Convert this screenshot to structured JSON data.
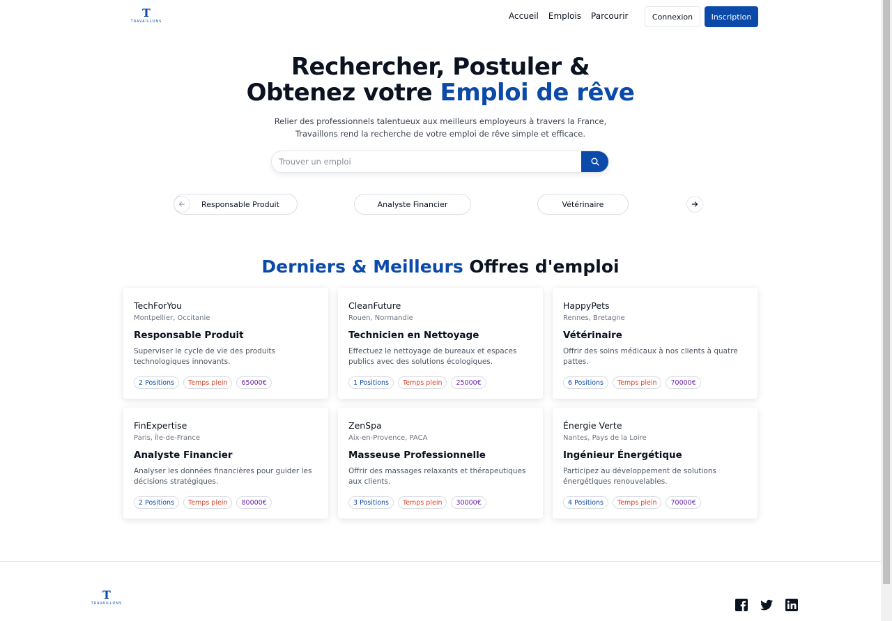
{
  "brand": {
    "mark": "T",
    "name": "TRAVAILLONS"
  },
  "nav": {
    "items": [
      "Accueil",
      "Emplois",
      "Parcourir"
    ],
    "login": "Connexion",
    "signup": "Inscription"
  },
  "hero": {
    "title_line1": "Rechercher, Postuler &",
    "title_line2_prefix": "Obtenez votre ",
    "title_line2_accent": "Emploi de rêve",
    "subtitle": "Relier des professionnels talentueux aux meilleurs employeurs à travers la France, Travaillons rend la recherche de votre emploi de rêve simple et efficace.",
    "search_placeholder": "Trouver un emploi"
  },
  "carousel": {
    "chips": [
      "Responsable Produit",
      "Analyste Financier",
      "Vétérinaire"
    ]
  },
  "section": {
    "title_accent": "Derniers & Meilleurs",
    "title_rest": " Offres d'emploi"
  },
  "jobs": [
    {
      "company": "TechForYou",
      "location": "Montpellier, Occitanie",
      "title": "Responsable Produit",
      "description": "Superviser le cycle de vie des produits technologiques innovants.",
      "positions": "2 Positions",
      "type": "Temps plein",
      "salary": "65000€"
    },
    {
      "company": "CleanFuture",
      "location": "Rouen, Normandie",
      "title": "Technicien en Nettoyage",
      "description": "Effectuez le nettoyage de bureaux et espaces publics avec des solutions écologiques.",
      "positions": "1 Positions",
      "type": "Temps plein",
      "salary": "25000€"
    },
    {
      "company": "HappyPets",
      "location": "Rennes, Bretagne",
      "title": "Vétérinaire",
      "description": "Offrir des soins médicaux à nos clients à quatre pattes.",
      "positions": "6 Positions",
      "type": "Temps plein",
      "salary": "70000€"
    },
    {
      "company": "FinExpertise",
      "location": "Paris, Île-de-France",
      "title": "Analyste Financier",
      "description": "Analyser les données financières pour guider les décisions stratégiques.",
      "positions": "2 Positions",
      "type": "Temps plein",
      "salary": "80000€"
    },
    {
      "company": "ZenSpa",
      "location": "Aix-en-Provence, PACA",
      "title": "Masseuse Professionnelle",
      "description": "Offrir des massages relaxants et thérapeutiques aux clients.",
      "positions": "3 Positions",
      "type": "Temps plein",
      "salary": "30000€"
    },
    {
      "company": "Énergie Verte",
      "location": "Nantes, Pays de la Loire",
      "title": "Ingénieur Énergétique",
      "description": "Participez au développement de solutions énergétiques renouvelables.",
      "positions": "4 Positions",
      "type": "Temps plein",
      "salary": "70000€"
    }
  ],
  "footer": {
    "social": [
      "facebook-icon",
      "twitter-icon",
      "linkedin-icon"
    ]
  },
  "colors": {
    "accent": "#0b4aa8",
    "tag_type": "#d4452c",
    "tag_salary": "#6b21a8"
  }
}
